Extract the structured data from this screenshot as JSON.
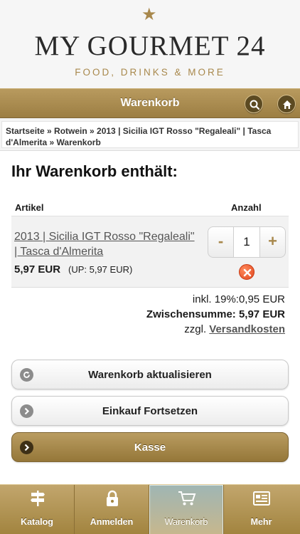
{
  "header": {
    "brand": "MY GOURMET 24",
    "tagline": "FOOD, DRINKS & MORE",
    "star_icon": "star-icon"
  },
  "titlebar": {
    "title": "Warenkorb",
    "search_icon": "search-icon",
    "home_icon": "home-icon"
  },
  "breadcrumb": {
    "text": "Startseite » Rotwein » 2013 | Sicilia IGT Rosso \"Regaleali\" | Tasca d'Almerita » Warenkorb"
  },
  "cart": {
    "heading": "Ihr Warenkorb enthält:",
    "col_article": "Artikel",
    "col_quantity": "Anzahl",
    "items": [
      {
        "name": "2013 | Sicilia IGT Rosso \"Regaleali\" | Tasca d'Almerita",
        "price": "5,97 EUR",
        "unit_price": "(UP: 5,97 EUR)",
        "quantity": "1",
        "minus": "-",
        "plus": "+"
      }
    ],
    "vat": "inkl. 19%:0,95 EUR",
    "subtotal": "Zwischensumme: 5,97 EUR",
    "shipping_prefix": "zzgl.",
    "shipping_link": "Versandkosten"
  },
  "buttons": {
    "update": "Warenkorb aktualisieren",
    "continue": "Einkauf Fortsetzen",
    "checkout": "Kasse"
  },
  "tabbar": {
    "tabs": [
      {
        "label": "Katalog",
        "icon": "signpost-icon"
      },
      {
        "label": "Anmelden",
        "icon": "lock-icon"
      },
      {
        "label": "Warenkorb",
        "icon": "cart-icon",
        "active": true
      },
      {
        "label": "Mehr",
        "icon": "more-icon"
      }
    ]
  },
  "colors": {
    "accent_gold": "#a8884c",
    "remove_red": "#e0471f"
  }
}
